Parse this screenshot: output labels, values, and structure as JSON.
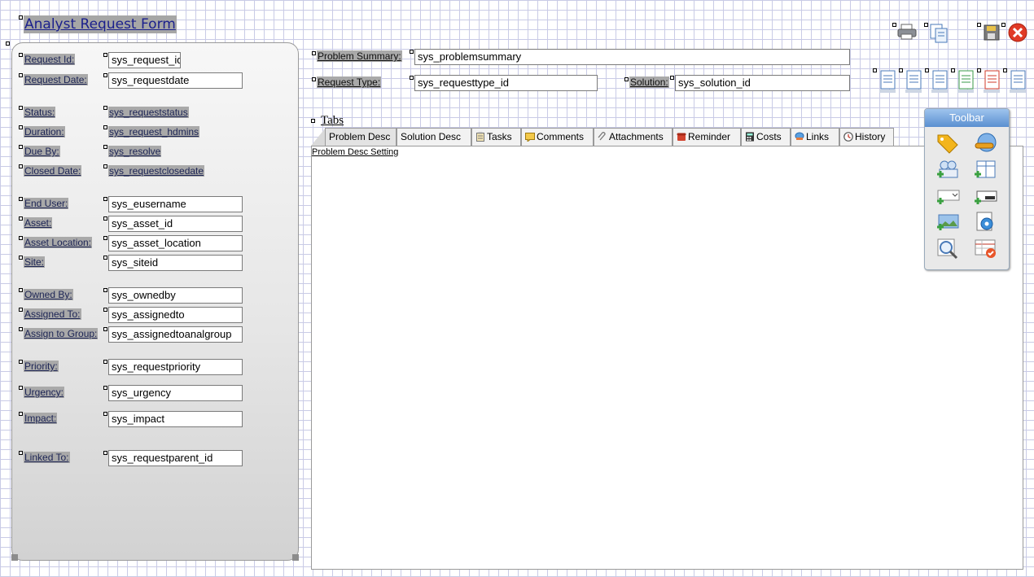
{
  "form": {
    "title": "Analyst Request Form"
  },
  "left_fields": [
    {
      "label": "Request Id:",
      "value": "sys_request_id",
      "kind": "input"
    },
    {
      "label": "Request Date:",
      "value": "sys_requestdate",
      "kind": "input"
    },
    {
      "label": "Status:",
      "value": "sys_requeststatus",
      "kind": "text"
    },
    {
      "label": "Duration:",
      "value": "sys_request_hdmins",
      "kind": "text"
    },
    {
      "label": "Due By:",
      "value": "sys_resolve",
      "kind": "text"
    },
    {
      "label": "Closed Date:",
      "value": "sys_requestclosedate",
      "kind": "text"
    },
    {
      "label": "End User:",
      "value": "sys_eusername",
      "kind": "input"
    },
    {
      "label": "Asset:",
      "value": "sys_asset_id",
      "kind": "input"
    },
    {
      "label": "Asset Location:",
      "value": "sys_asset_location",
      "kind": "input"
    },
    {
      "label": "Site:",
      "value": "sys_siteid",
      "kind": "input"
    },
    {
      "label": "Owned By:",
      "value": "sys_ownedby",
      "kind": "input"
    },
    {
      "label": "Assigned To:",
      "value": "sys_assignedto",
      "kind": "input"
    },
    {
      "label": "Assign to Group:",
      "value": "sys_assignedtoanalgroup",
      "kind": "input"
    },
    {
      "label": "Priority:",
      "value": "sys_requestpriority",
      "kind": "input"
    },
    {
      "label": "Urgency:",
      "value": "sys_urgency",
      "kind": "input"
    },
    {
      "label": "Impact:",
      "value": "sys_impact",
      "kind": "input"
    },
    {
      "label": "Linked To:",
      "value": "sys_requestparent_id",
      "kind": "input"
    }
  ],
  "top_fields": {
    "problem_summary": {
      "label": "Problem Summary:",
      "value": "sys_problemsummary"
    },
    "request_type": {
      "label": "Request Type:",
      "value": "sys_requesttype_id"
    },
    "solution": {
      "label": "Solution:",
      "value": "sys_solution_id"
    }
  },
  "tabs": {
    "heading": "Tabs",
    "items": [
      {
        "label": "Problem Desc",
        "icon": "none"
      },
      {
        "label": "Solution Desc",
        "icon": "none"
      },
      {
        "label": "Tasks",
        "icon": "clipboard-icon"
      },
      {
        "label": "Comments",
        "icon": "comment-icon"
      },
      {
        "label": "Attachments",
        "icon": "paperclip-icon"
      },
      {
        "label": "Reminder",
        "icon": "phone-icon"
      },
      {
        "label": "Costs",
        "icon": "calculator-icon"
      },
      {
        "label": "Links",
        "icon": "link-icon"
      },
      {
        "label": "History",
        "icon": "clock-icon"
      }
    ],
    "active_content": "Problem Desc Setting"
  },
  "toolbar": {
    "title": "Toolbar",
    "buttons": [
      "tag-icon",
      "globe-icon",
      "add-group-icon",
      "add-table-icon",
      "add-dropdown-icon",
      "add-field-icon",
      "add-image-icon",
      "settings-gear-icon",
      "search-zoom-icon",
      "grid-check-icon"
    ]
  },
  "colors": {
    "label_bg": "#a9a9a9",
    "label_text": "#1c2454",
    "title_text": "#1a1f8c",
    "grid": "#c9cbe6",
    "toolbar_header": "#5a8fd0"
  }
}
